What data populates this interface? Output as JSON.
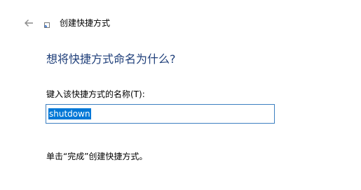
{
  "window": {
    "title": "创建快捷方式",
    "back_icon": "back-arrow-icon",
    "shortcut_icon": "shortcut-icon"
  },
  "main": {
    "heading": "想将快捷方式命名为什么?",
    "name_label": "键入该快捷方式的名称(T):",
    "name_value": "shutdown",
    "hint": "单击“完成”创建快捷方式。"
  },
  "colors": {
    "heading": "#1f3f7a",
    "input_border": "#3c7fc1",
    "selection": "#0078d7"
  }
}
